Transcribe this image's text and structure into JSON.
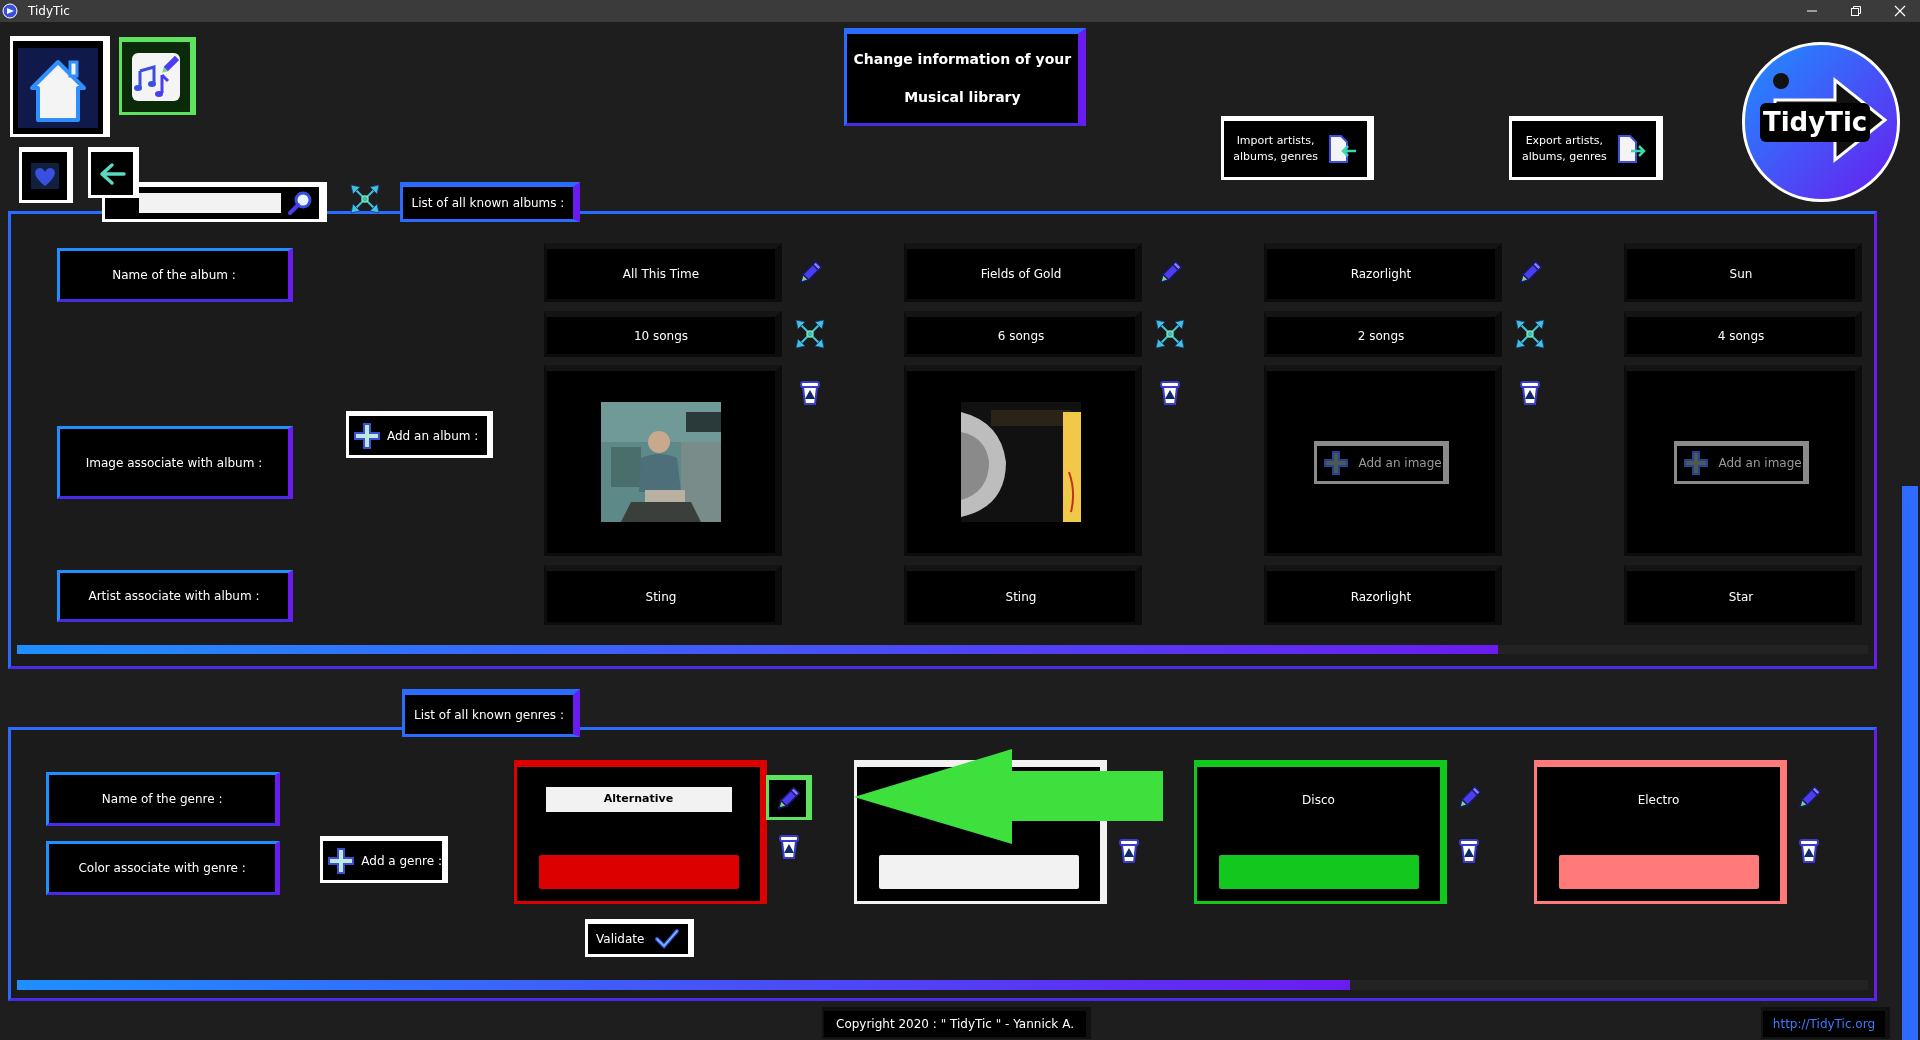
{
  "window": {
    "title": "TidyTic"
  },
  "header": {
    "lines": [
      "Change information of your",
      "Musical library"
    ]
  },
  "import_button": {
    "lines": [
      "Import artists,",
      "albums, genres"
    ]
  },
  "export_button": {
    "lines": [
      "Export artists,",
      "albums, genres"
    ]
  },
  "logo": {
    "text": "TidyTic"
  },
  "albums": {
    "tab": "List of all known albums :",
    "labels": [
      "Name of the album :",
      "Image associate with album :",
      "Artist associate with album :"
    ],
    "add_button": "Add an album :",
    "items": [
      {
        "name": "All This Time",
        "songs": "10 songs",
        "artist": "Sting",
        "tools": true
      },
      {
        "name": "Fields of Gold",
        "songs": "6 songs",
        "artist": "Sting",
        "tools": true
      },
      {
        "name": "Razorlight",
        "songs": "2 songs",
        "image": {
          "kind": "empty",
          "button": "Add an image"
        },
        "artist": "Razorlight",
        "tools": true
      },
      {
        "name": "Sun",
        "songs": "4 songs",
        "image": {
          "kind": "empty",
          "button": "Add an image"
        },
        "artist": "Star",
        "tools": false
      }
    ],
    "scroll": {
      "level": 0.8
    }
  },
  "genres": {
    "tab": "List of all known genres :",
    "labels": [
      "Name of the genre :",
      "Color associate with genre :"
    ],
    "add_button": "Add a genre :",
    "items": [
      {
        "name": "Alternative",
        "color": "#dd0000",
        "editing": true
      },
      {
        "color": "#f2f2f2",
        "editing": false
      },
      {
        "name": "Disco",
        "color": "#12c81e",
        "editing": false
      },
      {
        "name": "Electro",
        "color": "#ff7a78",
        "editing": false
      }
    ],
    "validate_button": "Validate",
    "scroll": {
      "level": 0.72
    }
  },
  "footer": {
    "copyright": "Copyright 2020 : \" TidyTic \" - Yannick A.",
    "link": "http://TidyTic.org"
  }
}
